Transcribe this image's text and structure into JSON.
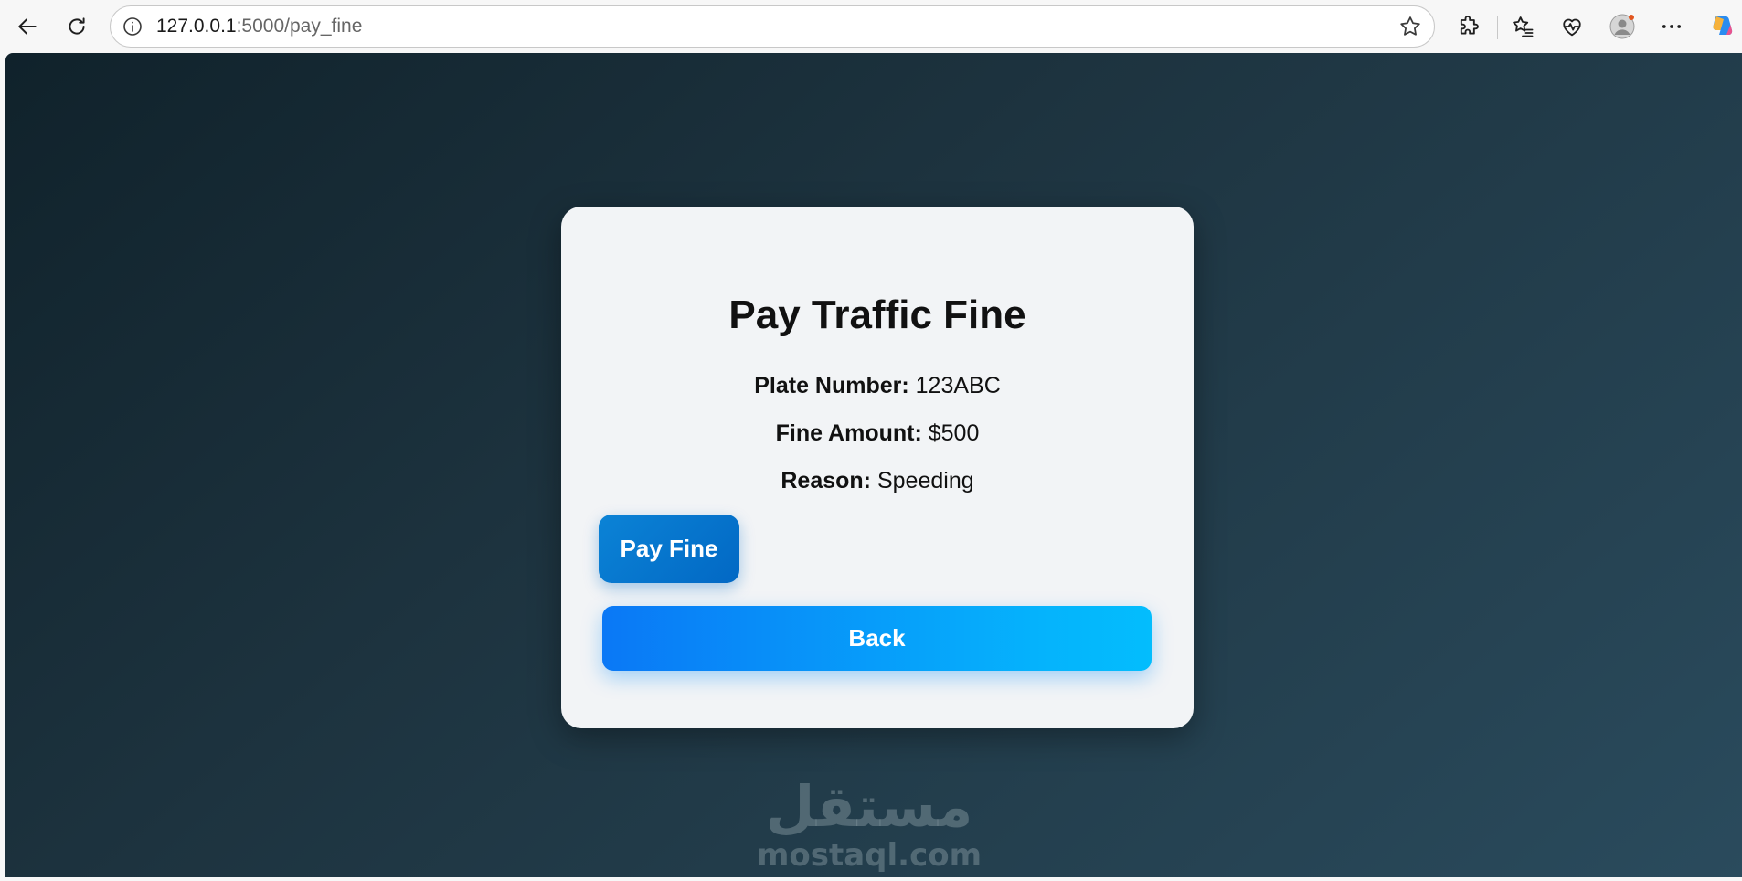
{
  "browser": {
    "url_host": "127.0.0.1",
    "url_path": ":5000/pay_fine"
  },
  "card": {
    "title": "Pay Traffic Fine",
    "plate_label": "Plate Number:",
    "plate_value": "123ABC",
    "amount_label": "Fine Amount:",
    "amount_value": "$500",
    "reason_label": "Reason:",
    "reason_value": "Speeding",
    "pay_button_label": "Pay Fine",
    "back_button_label": "Back"
  },
  "watermark": {
    "arabic": "مستقل",
    "latin": "mostaql.com"
  },
  "colors": {
    "pay_button": "#0b83d6",
    "back_button_start": "#0a78f6",
    "back_button_end": "#03bdfd",
    "card_background": "#f2f4f6",
    "page_background": "#1d333f"
  },
  "icons": {
    "back": "back-arrow-icon",
    "reload": "reload-icon",
    "site_info": "info-icon",
    "favorite": "star-icon",
    "extensions": "puzzle-icon",
    "favorites": "favorites-list-icon",
    "health": "heartbeat-icon",
    "profile": "profile-avatar-icon",
    "more": "more-dots-icon",
    "copilot": "copilot-icon"
  }
}
